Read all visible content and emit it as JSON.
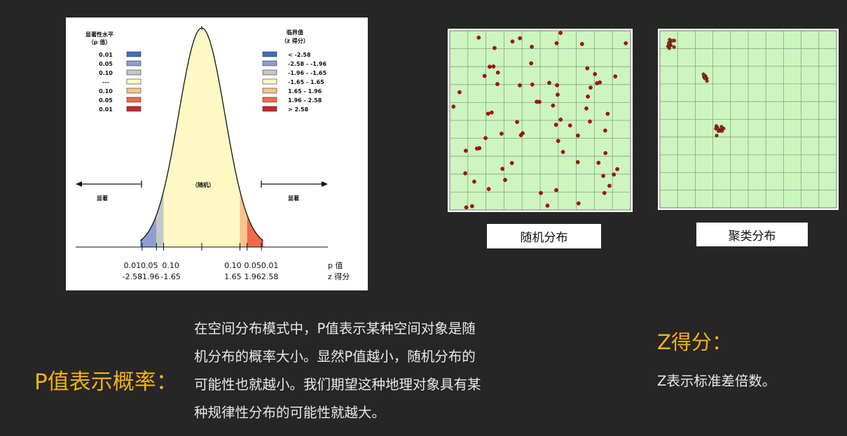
{
  "curve": {
    "left_legend_title_line1": "显著性水平",
    "left_legend_title_line2": "（p 值）",
    "right_legend_title_line1": "临界值",
    "right_legend_title_line2": "（z 得分）",
    "legend_rows": [
      {
        "p": "0.01",
        "range": "< -2.58",
        "color": "#3f6fbd"
      },
      {
        "p": "0.05",
        "range": "-2.58 - -1.96",
        "color": "#8d9fcf"
      },
      {
        "p": "0.10",
        "range": "-1.96 - -1.65",
        "color": "#c4c8c4"
      },
      {
        "p": "---",
        "range": "-1.65 - 1.65",
        "color": "#fdf8c4"
      },
      {
        "p": "0.10",
        "range": "1.65 - 1.96",
        "color": "#f7c48c"
      },
      {
        "p": "0.05",
        "range": "1.96 - 2.58",
        "color": "#ef6a4c"
      },
      {
        "p": "0.01",
        "range": "> 2.58",
        "color": "#c9262c"
      }
    ],
    "center_label": "（随机）",
    "left_signif_label": "显著",
    "right_signif_label": "显著",
    "p_ticks": [
      "0.01",
      "0.05",
      "0.10",
      "0.10",
      "0.05",
      "0.01"
    ],
    "z_ticks": [
      "-2.58",
      "-1.96",
      "-1.65",
      "1.65",
      "1.96",
      "2.58"
    ],
    "p_axis_label": "p 值",
    "z_axis_label": "z 得分"
  },
  "random_map_caption": "随机分布",
  "cluster_map_caption": "聚类分布",
  "p_section": {
    "title": "P值表示概率：",
    "lines": [
      "在空间分布模式中，P值表示某种空间对象是随",
      "机分布的概率大小。显然P值越小，随机分布的",
      "可能性也就越小。我们期望这种地理对象具有某",
      "种规律性分布的可能性就越大。"
    ]
  },
  "z_section": {
    "title": "Z得分：",
    "body": "Z表示标准差倍数。"
  },
  "colors": {
    "accent": "#f2b112",
    "map_fill": "#ccf5c0",
    "map_grid": "#8aa38a",
    "dot": "#b01010",
    "cluster_dot": "#9a2a1a"
  }
}
